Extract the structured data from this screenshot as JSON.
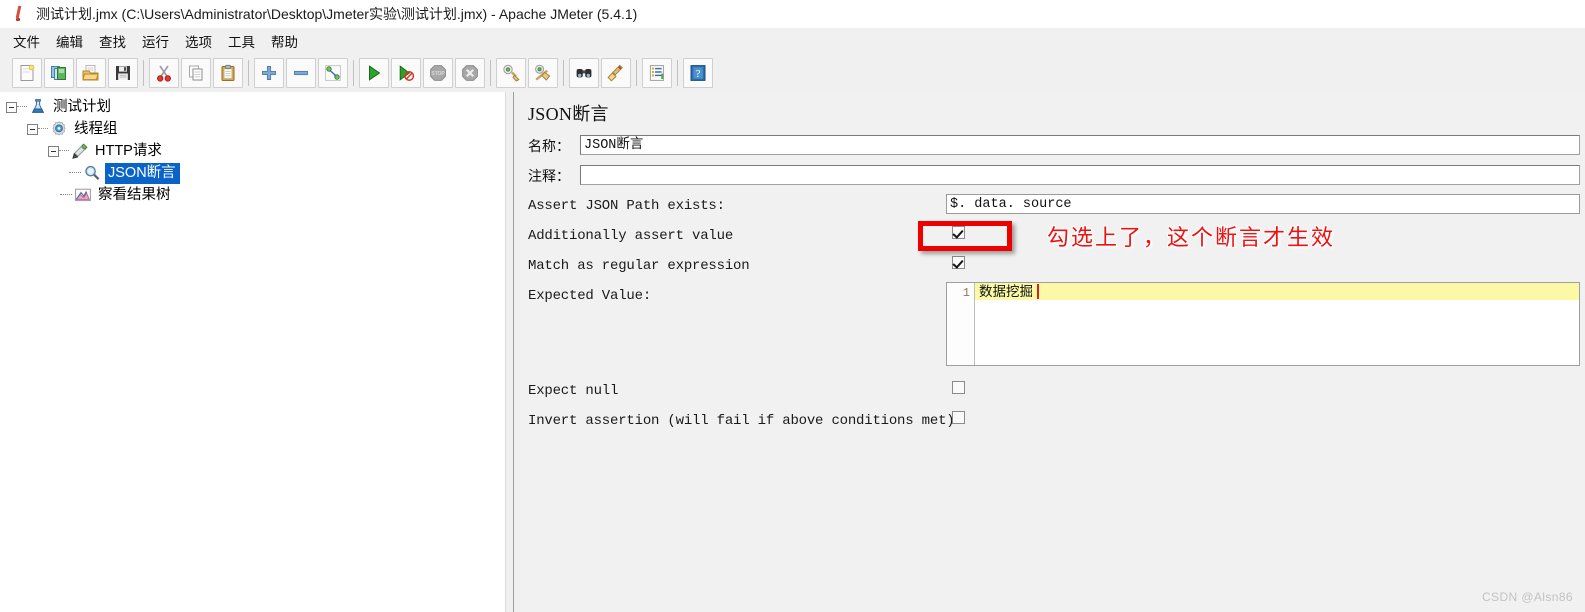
{
  "window": {
    "title": "测试计划.jmx (C:\\Users\\Administrator\\Desktop\\Jmeter实验\\测试计划.jmx) - Apache JMeter (5.4.1)",
    "app_icon": "jmeter-feather-icon"
  },
  "menubar": {
    "items": [
      {
        "label": "文件",
        "name": "menu-file"
      },
      {
        "label": "编辑",
        "name": "menu-edit"
      },
      {
        "label": "查找",
        "name": "menu-search"
      },
      {
        "label": "运行",
        "name": "menu-run"
      },
      {
        "label": "选项",
        "name": "menu-options"
      },
      {
        "label": "工具",
        "name": "menu-tools"
      },
      {
        "label": "帮助",
        "name": "menu-help"
      }
    ]
  },
  "toolbar": {
    "groups": [
      [
        {
          "icon": "new-document-icon",
          "name": "toolbar-new"
        },
        {
          "icon": "templates-icon",
          "name": "toolbar-templates"
        },
        {
          "icon": "open-folder-icon",
          "name": "toolbar-open"
        },
        {
          "icon": "save-floppy-icon",
          "name": "toolbar-save"
        }
      ],
      [
        {
          "icon": "cut-scissors-icon",
          "name": "toolbar-cut"
        },
        {
          "icon": "copy-icon",
          "name": "toolbar-copy"
        },
        {
          "icon": "paste-clipboard-icon",
          "name": "toolbar-paste"
        }
      ],
      [
        {
          "icon": "expand-plus-icon",
          "name": "toolbar-expand-all"
        },
        {
          "icon": "collapse-minus-icon",
          "name": "toolbar-collapse-all"
        },
        {
          "icon": "toggle-node-icon",
          "name": "toolbar-toggle"
        }
      ],
      [
        {
          "icon": "start-play-icon",
          "name": "toolbar-start"
        },
        {
          "icon": "start-no-timers-icon",
          "name": "toolbar-start-no-pauses"
        },
        {
          "icon": "stop-octagon-icon",
          "name": "toolbar-stop"
        },
        {
          "icon": "shutdown-icon",
          "name": "toolbar-shutdown"
        }
      ],
      [
        {
          "icon": "clear-broom-icon",
          "name": "toolbar-clear"
        },
        {
          "icon": "clear-all-broom-icon",
          "name": "toolbar-clear-all"
        }
      ],
      [
        {
          "icon": "search-binoculars-icon",
          "name": "toolbar-search"
        },
        {
          "icon": "reset-search-broom-icon",
          "name": "toolbar-reset-search"
        }
      ],
      [
        {
          "icon": "function-helper-icon",
          "name": "toolbar-function-helper"
        }
      ],
      [
        {
          "icon": "help-book-icon",
          "name": "toolbar-help"
        }
      ]
    ]
  },
  "tree": {
    "nodes": [
      {
        "label": "测试计划",
        "icon": "test-plan-icon",
        "depth": 0,
        "expanded": true,
        "selected": false
      },
      {
        "label": "线程组",
        "icon": "thread-group-gear-icon",
        "depth": 1,
        "expanded": true,
        "selected": false
      },
      {
        "label": "HTTP请求",
        "icon": "http-request-pen-icon",
        "depth": 2,
        "expanded": true,
        "selected": false
      },
      {
        "label": "JSON断言",
        "icon": "json-assertion-magnifier-icon",
        "depth": 3,
        "expanded": false,
        "selected": true
      },
      {
        "label": "察看结果树",
        "icon": "view-results-tree-icon",
        "depth": 2,
        "expanded": false,
        "selected": false
      }
    ]
  },
  "detail": {
    "title": "JSON断言",
    "name_label": "名称：",
    "name_value": "JSON断言",
    "comment_label": "注释：",
    "comment_value": "",
    "assert_path_label": "Assert JSON Path exists:",
    "assert_path_value": "$. data. source",
    "additionally_assert_label": "Additionally assert value",
    "additionally_assert_checked": true,
    "match_regex_label": "Match as regular expression",
    "match_regex_checked": true,
    "expected_value_label": "Expected Value:",
    "expected_value_line_number": "1",
    "expected_value_text": "数据挖掘",
    "expect_null_label": "Expect null",
    "expect_null_checked": false,
    "invert_assertion_label": "Invert assertion (will fail if above conditions met)",
    "invert_assertion_checked": false
  },
  "annotation": {
    "text": "勾选上了，这个断言才生效",
    "color": "#f01010",
    "box_color": "#ee0000"
  },
  "watermark": {
    "text": "CSDN @Alsn86"
  }
}
